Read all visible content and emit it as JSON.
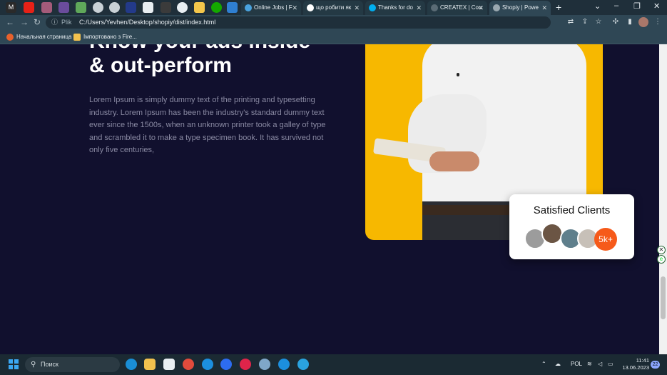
{
  "browser": {
    "tabs": [
      {
        "label": "Online Jobs | F",
        "favicon_color": "#4aa3df"
      },
      {
        "label": "що робити як",
        "favicon_color": "#ffffff"
      },
      {
        "label": "Thanks for do",
        "favicon_color": "#00aff0"
      },
      {
        "label": "CREATEX | Cou",
        "favicon_color": "#5a6b75"
      },
      {
        "label": "Shopiy | Powe",
        "favicon_color": "#9aa8b0"
      }
    ],
    "address": {
      "prefix": "Plik",
      "url": "C:/Users/Yevhen/Desktop/shopiy/dist/index.html"
    },
    "bookmarks": [
      {
        "label": "Начальная страница",
        "icon": "firefox-icon"
      },
      {
        "label": "Імпортовано з Fire...",
        "icon": "folder-icon"
      }
    ],
    "new_tab_symbol": "+",
    "window_controls": {
      "collapse": "⌄",
      "minimize": "–",
      "maximize": "❐",
      "close": "✕"
    }
  },
  "hero": {
    "heading_line1": "Know your ads inside",
    "heading_line2": "& out-perform",
    "paragraph": "Lorem Ipsum is simply dummy text of the printing and typesetting industry. Lorem Ipsum has been the industry's standard dummy text ever since the 1500s, when an unknown printer took a galley of type and scrambled it to make a type specimen book. It has survived not only five centuries,"
  },
  "clients_card": {
    "title": "Satisfied Clients",
    "count": "5k+",
    "accent_color": "#f65a1a"
  },
  "colors": {
    "page_background": "#11102e",
    "photo_background": "#f7b800",
    "paragraph_text": "#8a8aa3"
  },
  "taskbar": {
    "search_placeholder": "Поиск",
    "language": "POL",
    "time": "11:41",
    "date": "13.06.2023",
    "notifications": "22"
  }
}
